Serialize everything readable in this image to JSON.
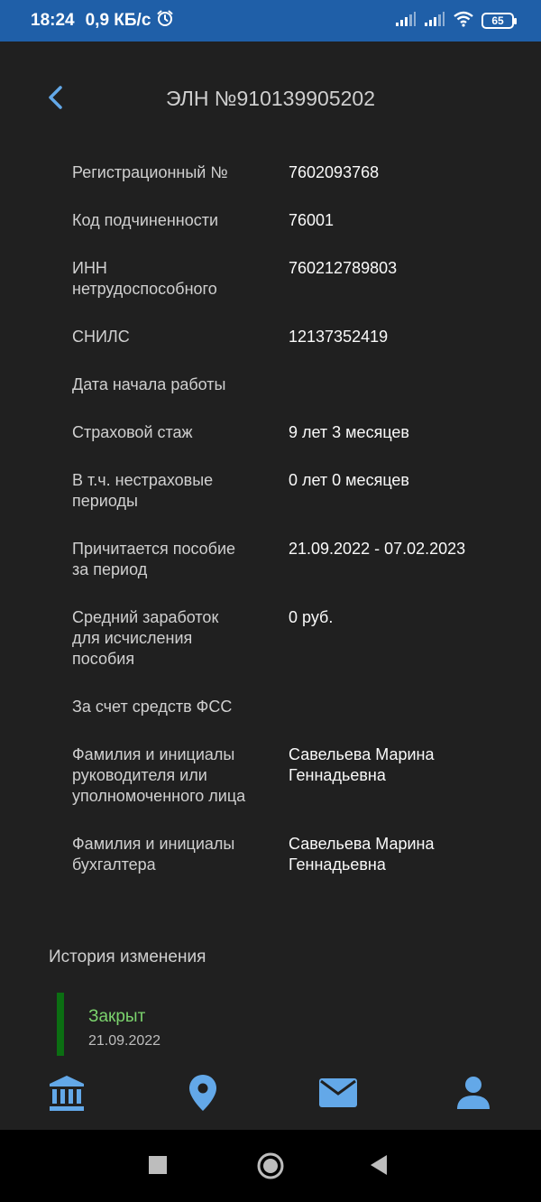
{
  "status_bar": {
    "time": "18:24",
    "speed": "0,9 КБ/с",
    "battery": "65"
  },
  "header": {
    "title": "ЭЛН №910139905202"
  },
  "details": [
    {
      "label": "Регистрационный №",
      "value": "7602093768"
    },
    {
      "label": "Код подчиненности",
      "value": "76001"
    },
    {
      "label": "ИНН\nнетрудоспособного",
      "value": "760212789803"
    },
    {
      "label": "СНИЛС",
      "value": "12137352419"
    },
    {
      "label": "Дата начала работы",
      "value": ""
    },
    {
      "label": "Страховой стаж",
      "value": "9 лет 3 месяцев"
    },
    {
      "label": "В т.ч. нестраховые\nпериоды",
      "value": "0 лет 0 месяцев"
    },
    {
      "label": "Причитается пособие\nза период",
      "value": "21.09.2022 - 07.02.2023"
    },
    {
      "label": "Средний заработок\nдля исчисления\nпособия",
      "value": "0 руб."
    },
    {
      "label": "За счет средств ФСС",
      "value": ""
    },
    {
      "label": "Фамилия и инициалы\nруководителя или\nуполномоченного лица",
      "value": "Савельева Марина\nГеннадьевна"
    },
    {
      "label": "Фамилия и инициалы\nбухгалтера",
      "value": "Савельева Марина\nГеннадьевна"
    }
  ],
  "history": {
    "title": "История изменения",
    "items": [
      {
        "status": "Закрыт",
        "date": "21.09.2022"
      }
    ]
  },
  "colors": {
    "accent": "#63a8e8",
    "status_bar": "#1f5fa8",
    "history_green": "#0b6e12"
  },
  "icons": {
    "back": "chevron-left-icon",
    "nav": [
      "bank-icon",
      "location-pin-icon",
      "mail-icon",
      "person-icon"
    ],
    "system": [
      "square-icon",
      "circle-icon",
      "triangle-back-icon"
    ]
  }
}
